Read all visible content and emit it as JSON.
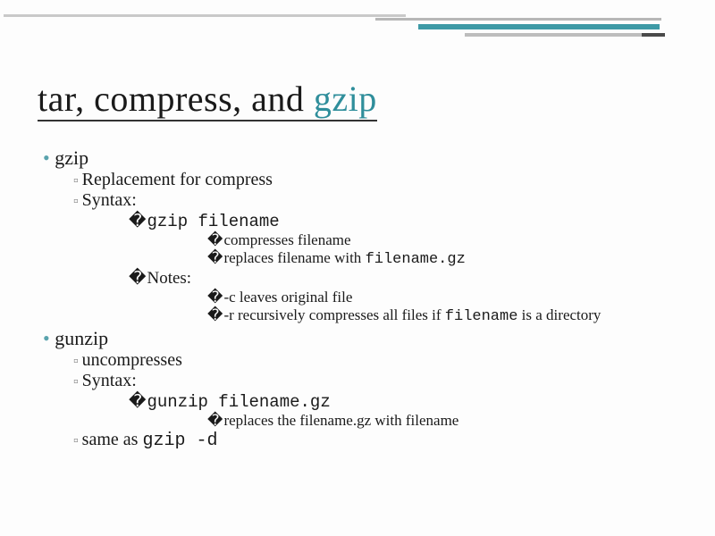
{
  "title": {
    "plain": "tar, compress, and ",
    "accent": "gzip"
  },
  "gzip": {
    "heading": "gzip",
    "replacement": "Replacement for compress",
    "syntax_label": "Syntax:",
    "cmd": "gzip filename",
    "cmd_d1": "compresses filename",
    "cmd_d2_a": "replaces filename with ",
    "cmd_d2_b": "filename.gz",
    "notes_label": "Notes:",
    "note1": "-c leaves original file",
    "note2_a": "-r recursively compresses all files if ",
    "note2_b": "filename",
    "note2_c": " is a directory"
  },
  "gunzip": {
    "heading": "gunzip",
    "uncompresses": "uncompresses",
    "syntax_label": "Syntax:",
    "cmd": "gunzip filename.gz",
    "cmd_d1": "replaces the filename.gz with filename",
    "same_a": "same as ",
    "same_b": "gzip -d"
  }
}
